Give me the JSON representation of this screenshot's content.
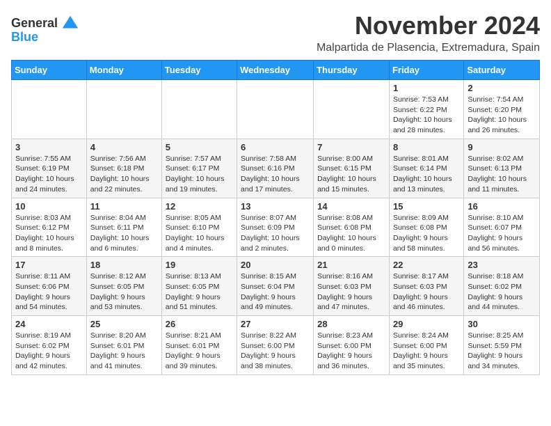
{
  "header": {
    "logo_line1": "General",
    "logo_line2": "Blue",
    "month_title": "November 2024",
    "subtitle": "Malpartida de Plasencia, Extremadura, Spain"
  },
  "weekdays": [
    "Sunday",
    "Monday",
    "Tuesday",
    "Wednesday",
    "Thursday",
    "Friday",
    "Saturday"
  ],
  "weeks": [
    [
      {
        "day": "",
        "info": ""
      },
      {
        "day": "",
        "info": ""
      },
      {
        "day": "",
        "info": ""
      },
      {
        "day": "",
        "info": ""
      },
      {
        "day": "",
        "info": ""
      },
      {
        "day": "1",
        "info": "Sunrise: 7:53 AM\nSunset: 6:22 PM\nDaylight: 10 hours and 28 minutes."
      },
      {
        "day": "2",
        "info": "Sunrise: 7:54 AM\nSunset: 6:20 PM\nDaylight: 10 hours and 26 minutes."
      }
    ],
    [
      {
        "day": "3",
        "info": "Sunrise: 7:55 AM\nSunset: 6:19 PM\nDaylight: 10 hours and 24 minutes."
      },
      {
        "day": "4",
        "info": "Sunrise: 7:56 AM\nSunset: 6:18 PM\nDaylight: 10 hours and 22 minutes."
      },
      {
        "day": "5",
        "info": "Sunrise: 7:57 AM\nSunset: 6:17 PM\nDaylight: 10 hours and 19 minutes."
      },
      {
        "day": "6",
        "info": "Sunrise: 7:58 AM\nSunset: 6:16 PM\nDaylight: 10 hours and 17 minutes."
      },
      {
        "day": "7",
        "info": "Sunrise: 8:00 AM\nSunset: 6:15 PM\nDaylight: 10 hours and 15 minutes."
      },
      {
        "day": "8",
        "info": "Sunrise: 8:01 AM\nSunset: 6:14 PM\nDaylight: 10 hours and 13 minutes."
      },
      {
        "day": "9",
        "info": "Sunrise: 8:02 AM\nSunset: 6:13 PM\nDaylight: 10 hours and 11 minutes."
      }
    ],
    [
      {
        "day": "10",
        "info": "Sunrise: 8:03 AM\nSunset: 6:12 PM\nDaylight: 10 hours and 8 minutes."
      },
      {
        "day": "11",
        "info": "Sunrise: 8:04 AM\nSunset: 6:11 PM\nDaylight: 10 hours and 6 minutes."
      },
      {
        "day": "12",
        "info": "Sunrise: 8:05 AM\nSunset: 6:10 PM\nDaylight: 10 hours and 4 minutes."
      },
      {
        "day": "13",
        "info": "Sunrise: 8:07 AM\nSunset: 6:09 PM\nDaylight: 10 hours and 2 minutes."
      },
      {
        "day": "14",
        "info": "Sunrise: 8:08 AM\nSunset: 6:08 PM\nDaylight: 10 hours and 0 minutes."
      },
      {
        "day": "15",
        "info": "Sunrise: 8:09 AM\nSunset: 6:08 PM\nDaylight: 9 hours and 58 minutes."
      },
      {
        "day": "16",
        "info": "Sunrise: 8:10 AM\nSunset: 6:07 PM\nDaylight: 9 hours and 56 minutes."
      }
    ],
    [
      {
        "day": "17",
        "info": "Sunrise: 8:11 AM\nSunset: 6:06 PM\nDaylight: 9 hours and 54 minutes."
      },
      {
        "day": "18",
        "info": "Sunrise: 8:12 AM\nSunset: 6:05 PM\nDaylight: 9 hours and 53 minutes."
      },
      {
        "day": "19",
        "info": "Sunrise: 8:13 AM\nSunset: 6:05 PM\nDaylight: 9 hours and 51 minutes."
      },
      {
        "day": "20",
        "info": "Sunrise: 8:15 AM\nSunset: 6:04 PM\nDaylight: 9 hours and 49 minutes."
      },
      {
        "day": "21",
        "info": "Sunrise: 8:16 AM\nSunset: 6:03 PM\nDaylight: 9 hours and 47 minutes."
      },
      {
        "day": "22",
        "info": "Sunrise: 8:17 AM\nSunset: 6:03 PM\nDaylight: 9 hours and 46 minutes."
      },
      {
        "day": "23",
        "info": "Sunrise: 8:18 AM\nSunset: 6:02 PM\nDaylight: 9 hours and 44 minutes."
      }
    ],
    [
      {
        "day": "24",
        "info": "Sunrise: 8:19 AM\nSunset: 6:02 PM\nDaylight: 9 hours and 42 minutes."
      },
      {
        "day": "25",
        "info": "Sunrise: 8:20 AM\nSunset: 6:01 PM\nDaylight: 9 hours and 41 minutes."
      },
      {
        "day": "26",
        "info": "Sunrise: 8:21 AM\nSunset: 6:01 PM\nDaylight: 9 hours and 39 minutes."
      },
      {
        "day": "27",
        "info": "Sunrise: 8:22 AM\nSunset: 6:00 PM\nDaylight: 9 hours and 38 minutes."
      },
      {
        "day": "28",
        "info": "Sunrise: 8:23 AM\nSunset: 6:00 PM\nDaylight: 9 hours and 36 minutes."
      },
      {
        "day": "29",
        "info": "Sunrise: 8:24 AM\nSunset: 6:00 PM\nDaylight: 9 hours and 35 minutes."
      },
      {
        "day": "30",
        "info": "Sunrise: 8:25 AM\nSunset: 5:59 PM\nDaylight: 9 hours and 34 minutes."
      }
    ]
  ]
}
